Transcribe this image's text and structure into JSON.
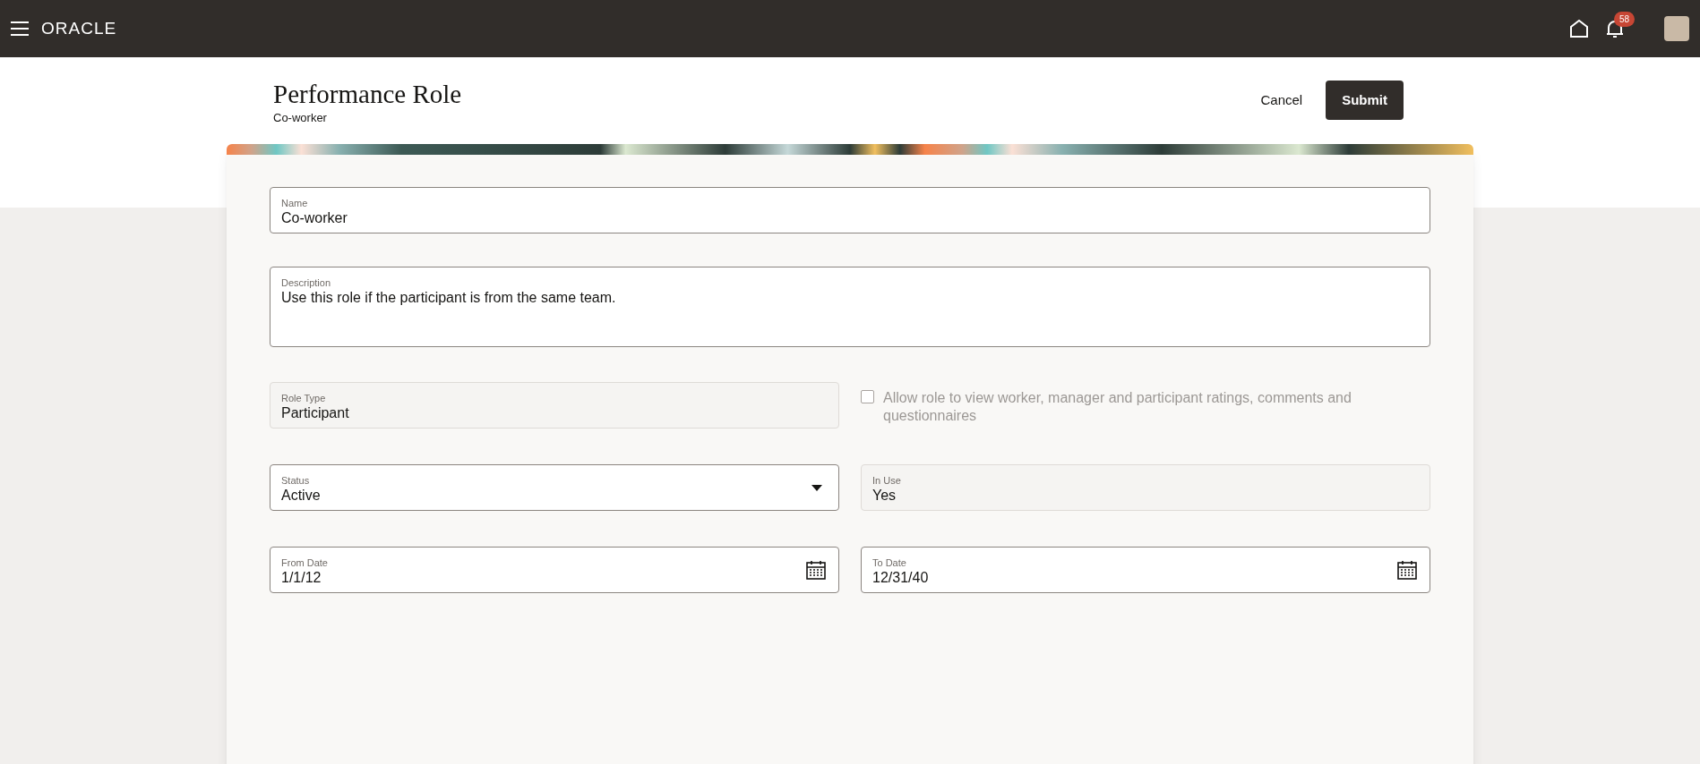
{
  "header": {
    "logo": "ORACLE",
    "notification_count": "58"
  },
  "page": {
    "title": "Performance Role",
    "subtitle": "Co-worker",
    "buttons": [
      {
        "label": "Cancel",
        "kind": "text"
      },
      {
        "label": "Submit",
        "kind": "primary"
      }
    ]
  },
  "form": {
    "name": {
      "label": "Name",
      "value": "Co-worker"
    },
    "description": {
      "label": "Description",
      "value": "Use this role if the participant is from the same team."
    },
    "rows": [
      [
        {
          "kind": "text",
          "label": "Role Type",
          "value": "Participant",
          "disabled": true
        },
        {
          "kind": "checkbox",
          "label": "Allow role to view worker, manager and participant ratings, comments and questionnaires",
          "checked": false,
          "disabled": true
        }
      ],
      [
        {
          "kind": "select",
          "label": "Status",
          "value": "Active",
          "disabled": false
        },
        {
          "kind": "text",
          "label": "In Use",
          "value": "Yes",
          "disabled": true
        }
      ],
      [
        {
          "kind": "date",
          "label": "From Date",
          "value": "1/1/12",
          "disabled": false
        },
        {
          "kind": "date",
          "label": "To Date",
          "value": "12/31/40",
          "disabled": false
        }
      ]
    ]
  }
}
